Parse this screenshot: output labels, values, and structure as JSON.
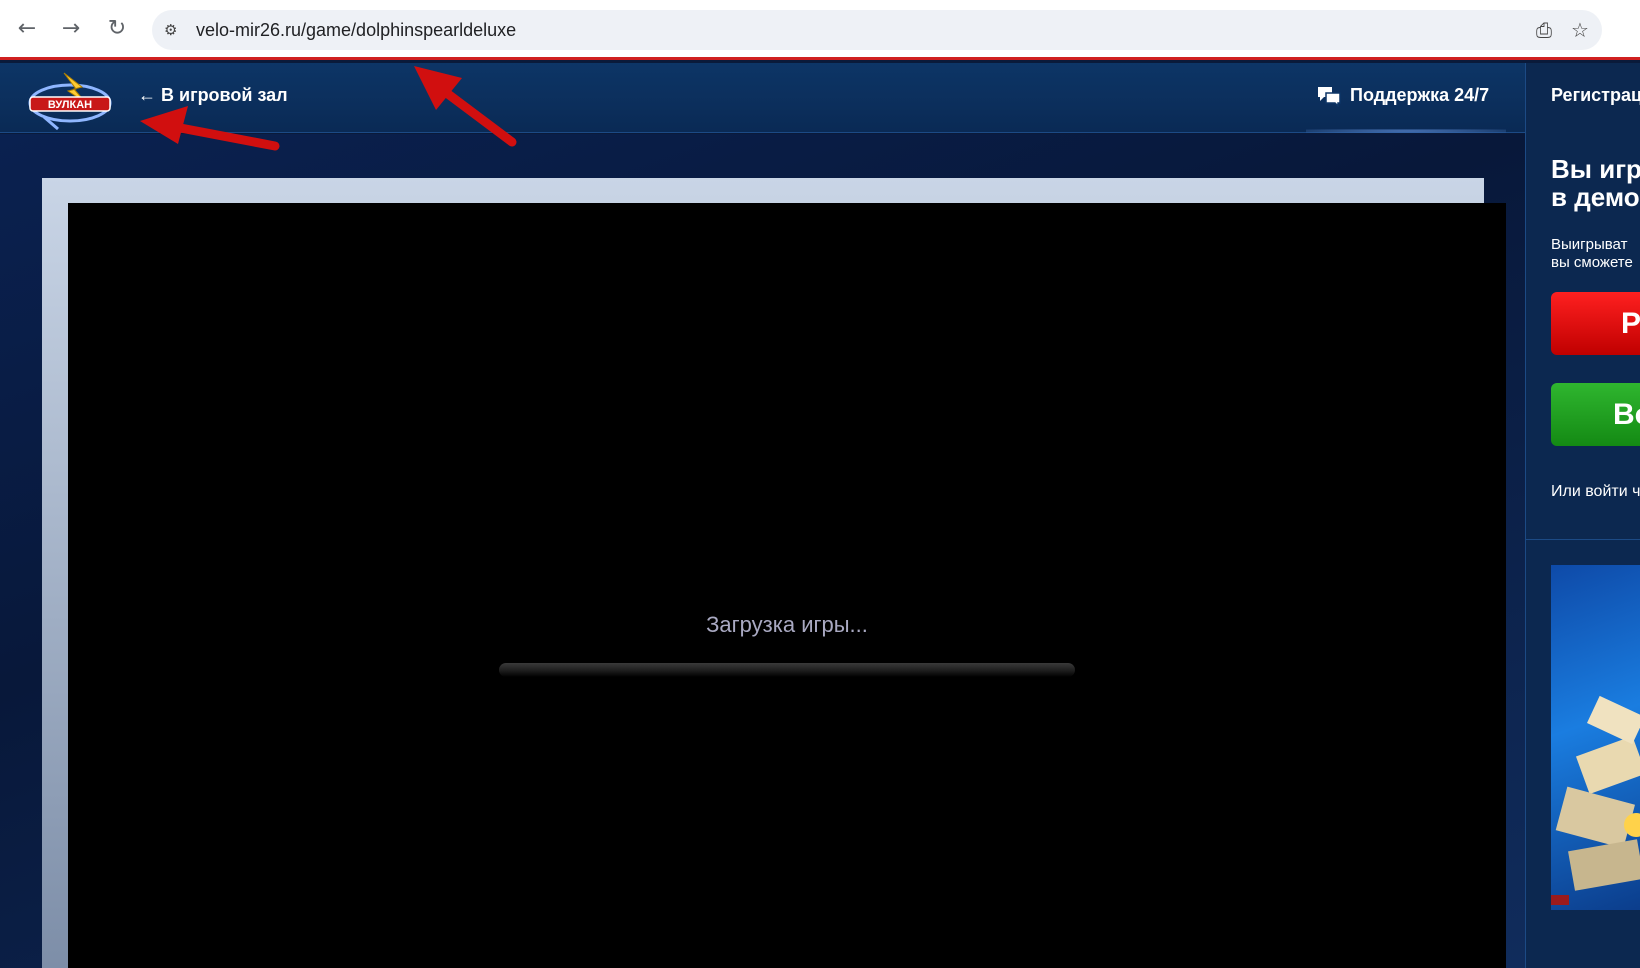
{
  "browser": {
    "url": "velo-mir26.ru/game/dolphinspearldeluxe",
    "back_icon": "arrow-left-icon",
    "forward_icon": "arrow-right-icon",
    "reload_icon": "reload-icon"
  },
  "header": {
    "logo_text": "ВУЛКАН",
    "back_link": "← В игровой зал",
    "support": "Поддержка 24/7",
    "register": "Регистрац"
  },
  "sidebar": {
    "title_line1": "Вы игра",
    "title_line2": "в демо",
    "text_line1": "Выигрыват",
    "text_line2": "вы сможете",
    "red_button": "Р",
    "green_button": "Во",
    "login_text": "Или войти ч"
  },
  "game": {
    "loading_text": "Загрузка игры...",
    "progress": 0
  },
  "colors": {
    "accent_red": "#d02020",
    "header_blue": "#0d3566",
    "button_red": "#e01010",
    "button_green": "#22a022"
  }
}
